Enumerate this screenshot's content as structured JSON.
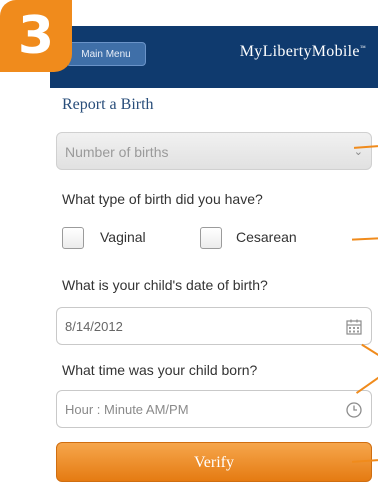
{
  "step_badge": "3",
  "header": {
    "menu_button": "Main Menu",
    "app_name": "MyLibertyMobile",
    "trademark": "™"
  },
  "form": {
    "section_title": "Report a Birth",
    "births_select": {
      "placeholder": "Number of births"
    },
    "birth_type_question": "What type of birth did you have?",
    "birth_type_options": [
      "Vaginal",
      "Cesarean"
    ],
    "dob_question": "What is your child's date of birth?",
    "dob_value": "8/14/2012",
    "time_question": "What time was your child born?",
    "time_placeholder": "Hour : Minute AM/PM",
    "verify_label": "Verify"
  },
  "colors": {
    "header": "#0f3a6e",
    "accent": "#f08b1c"
  }
}
